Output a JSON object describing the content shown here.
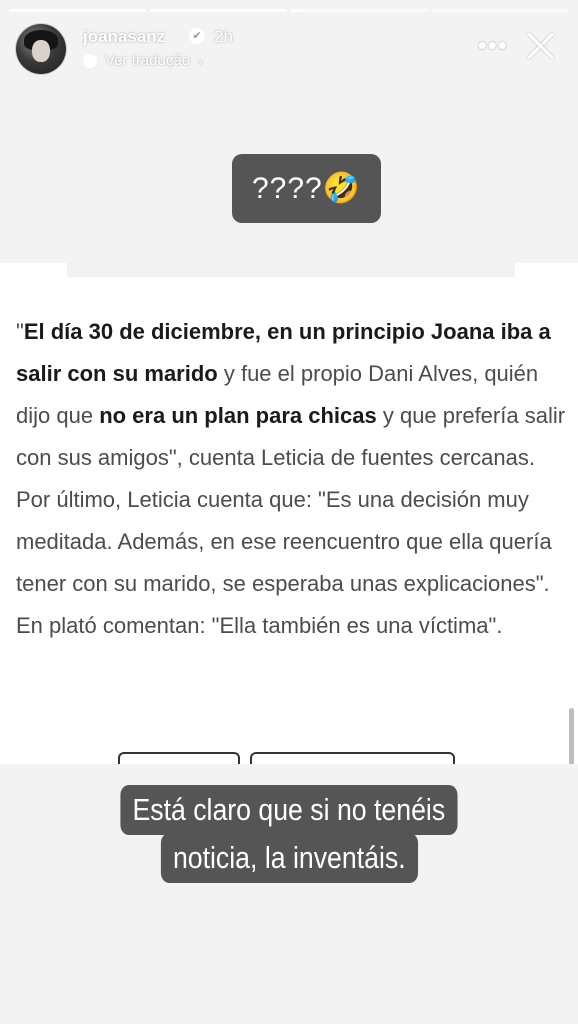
{
  "progress": [
    1,
    1,
    0.05,
    0
  ],
  "header": {
    "username": "joanasanz",
    "verified_icon": "✔",
    "time": "2h",
    "translate_label": "Ver tradução",
    "translate_chevron": "›",
    "more_label": "•••"
  },
  "sticker": {
    "text": "????🤣"
  },
  "article": {
    "segments": [
      {
        "text": "\"",
        "bold": false
      },
      {
        "text": "El día 30 de diciembre, en un principio Joana iba a salir con su marido",
        "bold": true
      },
      {
        "text": " y fue el propio Dani Alves, quién dijo que ",
        "bold": false
      },
      {
        "text": "no era un plan para chicas",
        "bold": true
      },
      {
        "text": " y que prefería salir con sus amigos\", cuenta Leticia de fuentes cercanas. Por último, Leticia cuenta que: \"Es una decisión muy meditada. Además, en ese reencuentro que ella quería tener con su marido, se esperaba unas explicaciones\". En plató comentan: \"Ella también es una víctima\".",
        "bold": false
      }
    ]
  },
  "caption": {
    "line1": "Está claro que si no tenéis",
    "line2": "noticia, la inventáis."
  }
}
